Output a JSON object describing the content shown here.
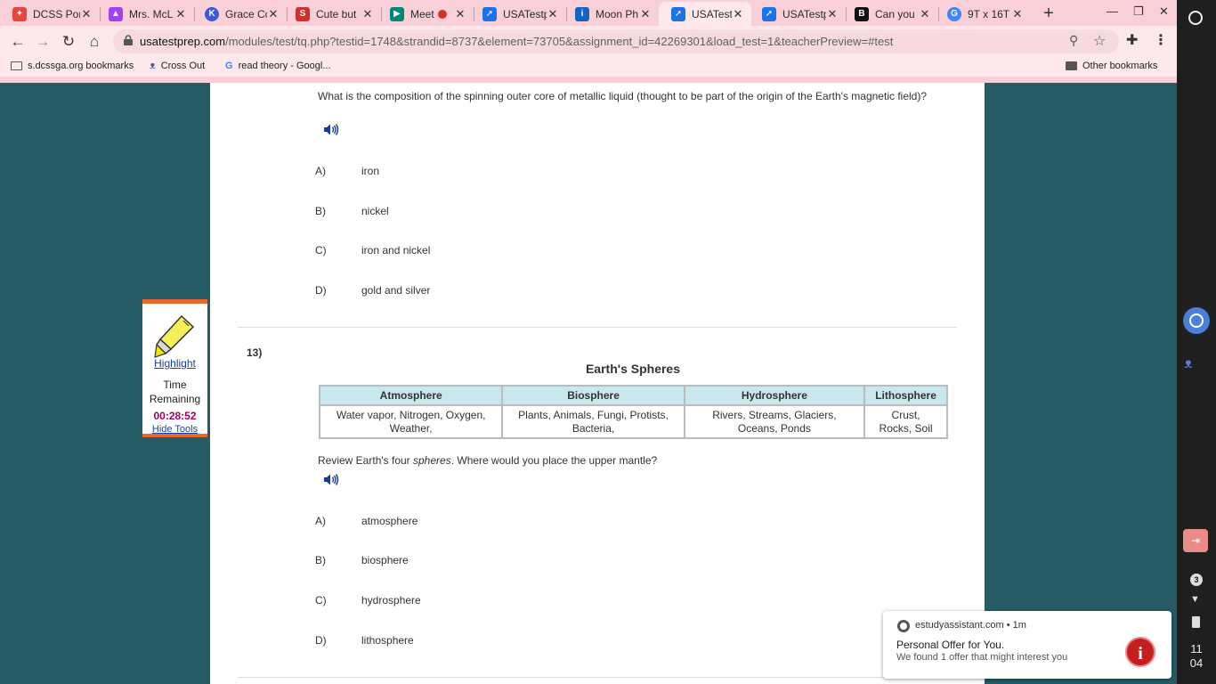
{
  "browser": {
    "tabs": [
      {
        "title": "DCSS Por",
        "icon": "dcss-icon",
        "color": "#e8453c"
      },
      {
        "title": "Mrs. McL",
        "icon": "classroom-icon",
        "color": "#a142f4"
      },
      {
        "title": "Grace Co",
        "icon": "kami-icon",
        "color": "#3b5bdb"
      },
      {
        "title": "Cute but",
        "icon": "scribd-icon",
        "color": "#d32f2f"
      },
      {
        "title": "Meet",
        "icon": "meet-icon",
        "color": "#00897b"
      },
      {
        "title": "USATestp",
        "icon": "cursor-icon",
        "color": "#1a73e8"
      },
      {
        "title": "Moon Ph",
        "icon": "ixl-icon",
        "color": "#1565c0"
      },
      {
        "title": "USATestp",
        "icon": "cursor-icon",
        "color": "#1a73e8"
      },
      {
        "title": "USATestp",
        "icon": "cursor-icon",
        "color": "#1a73e8"
      },
      {
        "title": "Can you",
        "icon": "brainly-icon",
        "color": "#111111"
      },
      {
        "title": "9T x 16T",
        "icon": "google-icon",
        "color": "#4285f4"
      }
    ],
    "url_host": "usatestprep.com",
    "url_rest": "/modules/test/tq.php?testid=1748&strandid=8737&element=73705&assignment_id=42269301&load_test=1&teacherPreview=#test",
    "bookmarks": [
      {
        "label": "s.dcssga.org bookmarks"
      },
      {
        "label": "Cross Out"
      },
      {
        "label": "read theory - Googl..."
      }
    ],
    "other_bookmarks": "Other bookmarks"
  },
  "question12": {
    "text": "What is the composition of the spinning outer core of metallic liquid (thought to be part of the origin of the Earth's magnetic field)?",
    "choices": [
      {
        "letter": "A)",
        "text": "iron"
      },
      {
        "letter": "B)",
        "text": "nickel"
      },
      {
        "letter": "C)",
        "text": "iron and nickel"
      },
      {
        "letter": "D)",
        "text": "gold and silver"
      }
    ]
  },
  "question13": {
    "number": "13)",
    "table_title": "Earth's Spheres",
    "headers": [
      "Atmosphere",
      "Biosphere",
      "Hydrosphere",
      "Lithosphere"
    ],
    "cells": [
      "Water vapor, Nitrogen, Oxygen, Weather,",
      "Plants, Animals, Fungi, Protists, Bacteria,",
      "Rivers, Streams, Glaciers, Oceans, Ponds",
      "Crust, Rocks, Soil"
    ],
    "text_before": "Review Earth's four ",
    "text_italic": "spheres",
    "text_after": ". Where would you place the upper mantle?",
    "choices": [
      {
        "letter": "A)",
        "text": "atmosphere"
      },
      {
        "letter": "B)",
        "text": "biosphere"
      },
      {
        "letter": "C)",
        "text": "hydrosphere"
      },
      {
        "letter": "D)",
        "text": "lithosphere"
      }
    ]
  },
  "tools": {
    "highlight": "Highlight",
    "time_label_1": "Time",
    "time_label_2": "Remaining",
    "timer": "00:28:52",
    "hide": "Hide Tools"
  },
  "notification": {
    "source": "estudyassistant.com",
    "age": "• 1m",
    "title": "Personal Offer for You.",
    "body": "We found 1 offer that might interest you"
  },
  "shelf": {
    "badge": "3",
    "clock_h": "11",
    "clock_m": "04"
  },
  "colors": {
    "page_bg": "#255c66",
    "tools_accent": "#e8672a",
    "timer": "#a0006e",
    "table_header": "#c9e8ee"
  }
}
